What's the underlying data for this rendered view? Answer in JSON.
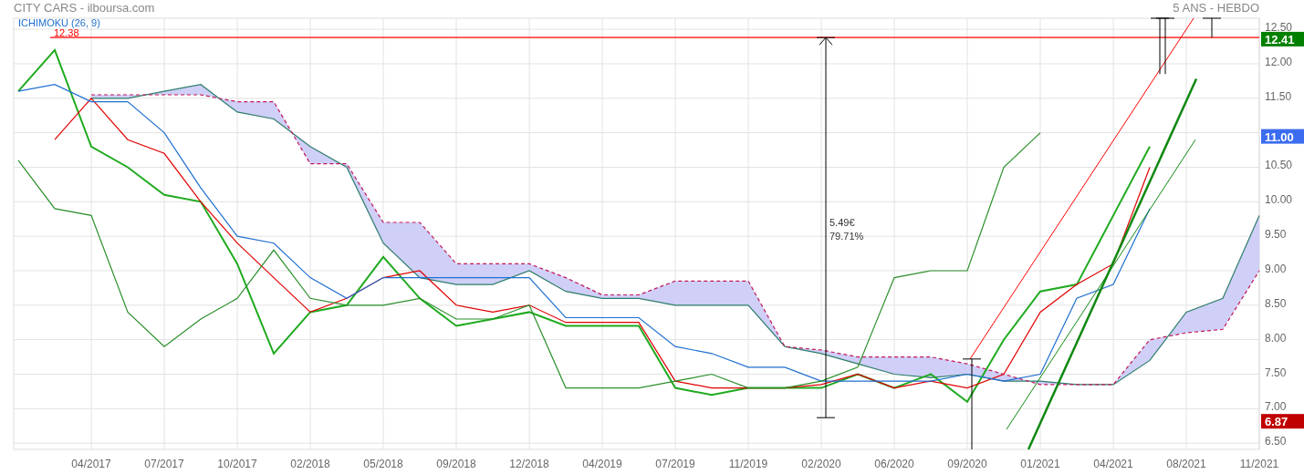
{
  "header": {
    "title": "CITY CARS - ilboursa.com",
    "period": "5 ANS - HEBDO"
  },
  "indicator": {
    "label": "ICHIMOKU (26, 9)"
  },
  "chart_data": {
    "type": "line",
    "grid": true,
    "categories": [
      null,
      null,
      "04/2017",
      null,
      "07/2017",
      null,
      "10/2017",
      null,
      "02/2018",
      null,
      "05/2018",
      null,
      "09/2018",
      null,
      "12/2018",
      null,
      "04/2019",
      null,
      "07/2019",
      null,
      "11/2019",
      null,
      "02/2020",
      null,
      "06/2020",
      null,
      "09/2020",
      null,
      "01/2021",
      null,
      "04/2021",
      null,
      "08/2021",
      null,
      "11/2021"
    ],
    "ylim": [
      6.41,
      12.66
    ],
    "yticks": [
      {
        "value": 6.5,
        "label": "6.50"
      },
      {
        "value": 7,
        "label": "7.00"
      },
      {
        "value": 7.5,
        "label": "7.50"
      },
      {
        "value": 8,
        "label": "8.00"
      },
      {
        "value": 8.5,
        "label": "8.50"
      },
      {
        "value": 9,
        "label": "9.00"
      },
      {
        "value": 9.5,
        "label": "9.50"
      },
      {
        "value": 10,
        "label": "10.00"
      },
      {
        "value": 10.5,
        "label": "10.50"
      },
      {
        "value": 11.5,
        "label": "11.50"
      },
      {
        "value": 12,
        "label": "12.00"
      },
      {
        "value": 12.5,
        "label": "12.50"
      }
    ],
    "series": [
      {
        "color": "#1faa1f",
        "values": [
          11.6,
          12.2,
          10.8,
          10.5,
          10.1,
          10.0,
          9.1,
          7.8,
          8.4,
          8.5,
          9.2,
          8.6,
          8.2,
          8.3,
          8.4,
          8.2,
          8.2,
          8.2,
          7.3,
          7.2,
          7.3,
          7.3,
          7.3,
          7.5,
          7.3,
          7.5,
          7.1,
          8.0,
          8.7,
          8.8,
          9.8,
          10.8,
          null,
          null,
          null
        ]
      },
      {
        "color": "#e00000",
        "values": [
          null,
          10.9,
          11.5,
          10.9,
          10.7,
          10.0,
          9.4,
          8.9,
          8.4,
          8.6,
          8.9,
          9.0,
          8.5,
          8.4,
          8.5,
          8.25,
          8.25,
          8.25,
          7.4,
          7.3,
          7.3,
          7.3,
          7.35,
          7.5,
          7.3,
          7.4,
          7.3,
          7.5,
          8.4,
          8.8,
          9.1,
          10.5,
          null,
          null,
          null
        ]
      },
      {
        "color": "#1f6fd1",
        "values": [
          11.6,
          11.7,
          11.45,
          11.45,
          11.0,
          10.2,
          9.5,
          9.4,
          8.9,
          8.6,
          8.9,
          8.9,
          8.9,
          8.9,
          8.9,
          8.32,
          8.32,
          8.32,
          7.9,
          7.8,
          7.6,
          7.6,
          7.4,
          7.4,
          7.4,
          7.4,
          7.5,
          7.4,
          7.5,
          8.6,
          8.8,
          9.9,
          null,
          null,
          null
        ]
      },
      {
        "color": "#2a8f2a",
        "values": [
          10.6,
          9.9,
          9.8,
          8.4,
          7.9,
          8.3,
          8.6,
          9.3,
          8.6,
          8.5,
          8.5,
          8.6,
          8.3,
          8.3,
          8.5,
          7.3,
          7.3,
          7.3,
          7.4,
          7.5,
          7.3,
          7.3,
          7.4,
          7.6,
          8.9,
          9.0,
          9.0,
          10.5,
          11.0,
          null,
          null,
          null,
          null,
          null,
          null
        ]
      },
      {
        "color": "#2e7d6b",
        "values": [
          null,
          null,
          11.5,
          11.5,
          11.6,
          11.7,
          11.3,
          11.2,
          10.8,
          10.5,
          9.4,
          8.9,
          8.8,
          8.8,
          9.0,
          8.7,
          8.6,
          8.6,
          8.5,
          8.5,
          8.5,
          7.9,
          7.8,
          7.65,
          7.5,
          7.45,
          7.5,
          7.4,
          7.4,
          7.35,
          7.35,
          7.7,
          8.4,
          8.6,
          9.8
        ]
      },
      {
        "color": "#c2185b",
        "line_style": "dashed",
        "values": [
          null,
          null,
          11.55,
          11.55,
          11.55,
          11.55,
          11.45,
          11.45,
          10.55,
          10.55,
          9.7,
          9.7,
          9.1,
          9.1,
          9.1,
          8.9,
          8.65,
          8.65,
          8.85,
          8.85,
          8.85,
          7.9,
          7.85,
          7.75,
          7.75,
          7.75,
          7.65,
          7.5,
          7.35,
          7.35,
          7.35,
          8.0,
          8.1,
          8.15,
          9.0
        ]
      }
    ]
  },
  "level_line": {
    "label": "12.38"
  },
  "measure": {
    "labels": [
      "5.49€",
      "79.71%"
    ]
  },
  "price_tags": [
    {
      "label": "12.41",
      "color": "#008000"
    },
    {
      "label": "11.00",
      "color": "#3c6cf0"
    },
    {
      "label": "6.87",
      "color": "#c00000"
    }
  ]
}
